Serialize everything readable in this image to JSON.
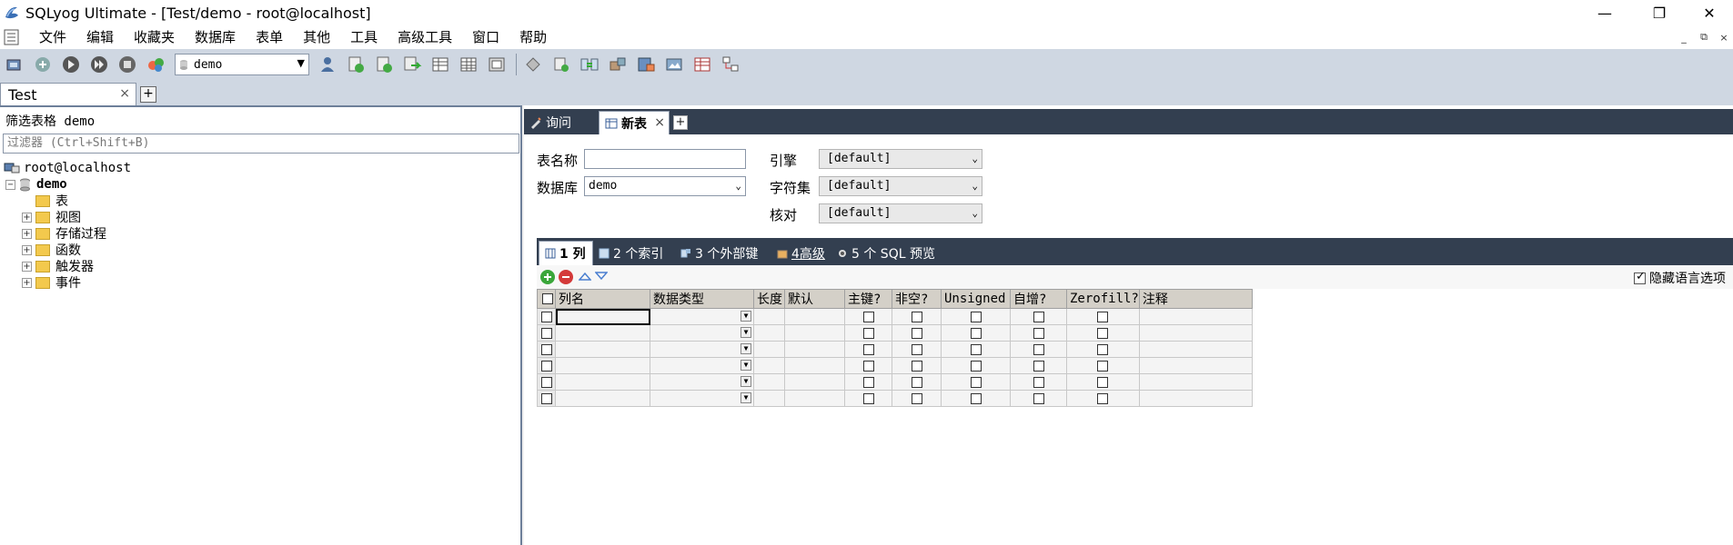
{
  "window": {
    "title": "SQLyog Ultimate - [Test/demo - root@localhost]",
    "controls": {
      "minimize": "—",
      "maximize": "❐",
      "close": "✕"
    }
  },
  "menu": {
    "items": [
      "文件",
      "编辑",
      "收藏夹",
      "数据库",
      "表单",
      "其他",
      "工具",
      "高级工具",
      "窗口",
      "帮助"
    ],
    "mdi_controls": {
      "minimize": "_",
      "restore": "⧉",
      "close": "×"
    }
  },
  "toolbar": {
    "database_select": "demo"
  },
  "connection_tab": {
    "label": "Test",
    "close": "×",
    "add": "+"
  },
  "object_browser": {
    "filter_label": "筛选表格 demo",
    "filter_placeholder": "过滤器 (Ctrl+Shift+B)",
    "connection": "root@localhost",
    "database": "demo",
    "database_expander": "−",
    "items": [
      {
        "label": "表",
        "expander": ""
      },
      {
        "label": "视图",
        "expander": "+"
      },
      {
        "label": "存储过程",
        "expander": "+"
      },
      {
        "label": "函数",
        "expander": "+"
      },
      {
        "label": "触发器",
        "expander": "+"
      },
      {
        "label": "事件",
        "expander": "+"
      }
    ]
  },
  "query_tabs": {
    "query": "询问",
    "new_table": "新表",
    "close": "×",
    "add": "+"
  },
  "table_form": {
    "table_name_label": "表名称",
    "table_name_value": "",
    "database_label": "数据库",
    "database_value": "demo",
    "engine_label": "引擎",
    "engine_value": "[default]",
    "charset_label": "字符集",
    "charset_value": "[default]",
    "collation_label": "核对",
    "collation_value": "[default]"
  },
  "sub_tabs": [
    "1 列",
    "2 个索引",
    "3 个外部键",
    "4高级",
    "5 个 SQL 预览"
  ],
  "grid_toolbar": {
    "hide_language_options": "隐藏语言选项",
    "hide_language_checked": true
  },
  "columns_grid": {
    "headers": [
      "列名",
      "数据类型",
      "长度",
      "默认",
      "主键?",
      "非空?",
      "Unsigned",
      "自增?",
      "Zerofill?",
      "注释"
    ],
    "row_count": 6
  }
}
